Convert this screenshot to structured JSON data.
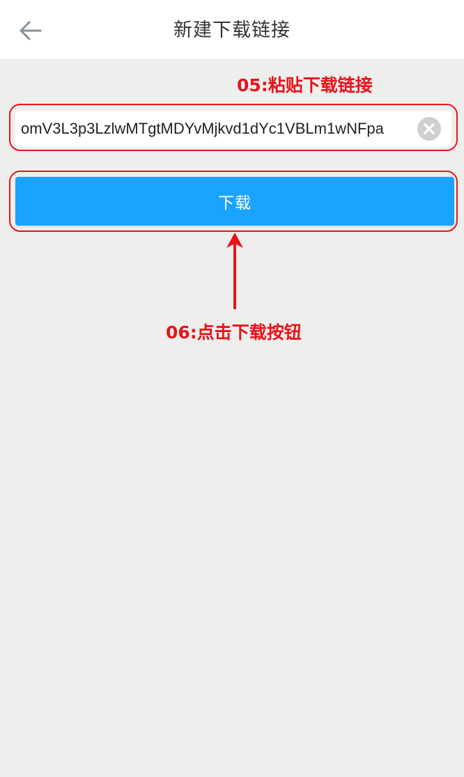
{
  "header": {
    "title": "新建下载链接",
    "back_icon": "back-arrow-icon"
  },
  "annotations": {
    "step_paste": "05:粘贴下载链接",
    "step_click": "06:点击下载按钮",
    "color": "#e8141a"
  },
  "link_input": {
    "value": "omV3L3p3LzlwMTgtMDYvMjkvd1dYc1VBLm1wNFpa",
    "clear_icon": "clear-circle-icon"
  },
  "actions": {
    "download_label": "下载"
  },
  "colors": {
    "accent": "#1aa3ff",
    "background": "#eeeeec",
    "header_bg": "#ffffff"
  }
}
